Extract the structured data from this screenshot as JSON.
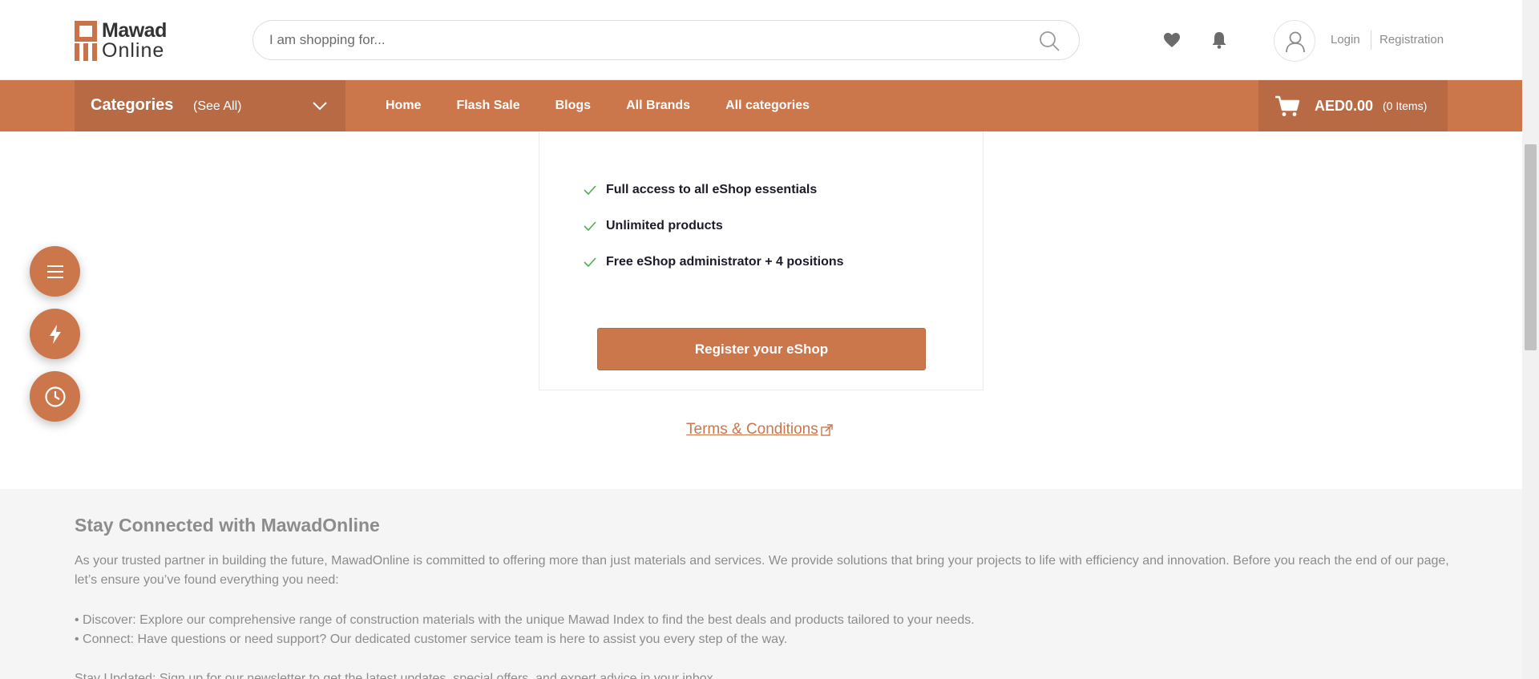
{
  "brand": {
    "line1": "Mawad",
    "line2": "Online"
  },
  "search": {
    "placeholder": "I am shopping for..."
  },
  "account": {
    "login": "Login",
    "registration": "Registration"
  },
  "nav": {
    "categories_title": "Categories",
    "categories_see_all": "(See All)",
    "links": [
      "Home",
      "Flash Sale",
      "Blogs",
      "All Brands",
      "All categories"
    ],
    "cart_amount": "AED0.00",
    "cart_items": "(0 Items)"
  },
  "plan": {
    "features": [
      "Full access to all eShop essentials",
      "Unlimited products",
      "Free eShop administrator + 4 positions"
    ],
    "register_button": "Register your eShop"
  },
  "terms_link": "Terms & Conditions",
  "footer": {
    "title": "Stay Connected with MawadOnline",
    "intro": "As your trusted partner in building the future, MawadOnline is committed to offering more than just materials and services. We provide solutions that bring your projects to life with efficiency and innovation. Before you reach the end of our page, let’s ensure you’ve found everything you need:",
    "discover": "• Discover: Explore our comprehensive range of construction materials with the unique Mawad Index to find the best deals and products tailored to your needs.",
    "connect": "• Connect: Have questions or need support? Our dedicated customer service team is here to assist you every step of the way.",
    "updated": "Stay Updated: Sign up for our newsletter to get the latest updates, special offers, and expert advice in your inbox."
  },
  "colors": {
    "brand": "#cb764b",
    "brand_dark": "#b86a44",
    "check": "#4caf50"
  },
  "icons": [
    "search-icon",
    "heart-icon",
    "bell-icon",
    "user-icon",
    "chevron-down-icon",
    "cart-icon",
    "check-icon",
    "external-link-icon",
    "menu-icon",
    "flash-icon",
    "clock-icon"
  ]
}
